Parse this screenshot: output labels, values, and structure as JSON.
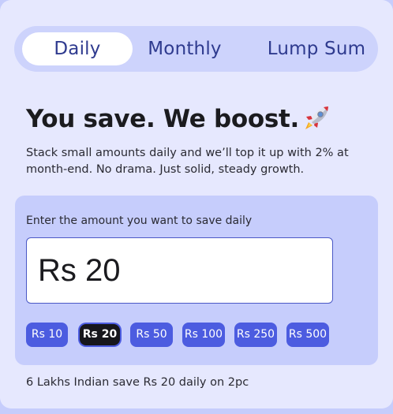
{
  "tabs": [
    {
      "label": "Daily",
      "active": true
    },
    {
      "label": "Monthly",
      "active": false
    },
    {
      "label": "Lump Sum",
      "active": false
    }
  ],
  "headline": {
    "text": "You save. We boost.",
    "icon": "rocket-icon"
  },
  "description": "Stack small amounts daily and we’ll top it up with 2% at month-end. No drama. Just solid, steady growth.",
  "amount": {
    "label": "Enter the amount you want to save daily",
    "value": "Rs 20"
  },
  "quick_amounts": [
    {
      "label": "Rs 10",
      "selected": false
    },
    {
      "label": "Rs 20",
      "selected": true
    },
    {
      "label": "Rs 50",
      "selected": false
    },
    {
      "label": "Rs 100",
      "selected": false
    },
    {
      "label": "Rs 250",
      "selected": false
    },
    {
      "label": "Rs 500",
      "selected": false
    }
  ],
  "footnote": "6 Lakhs Indian save Rs 20 daily on 2pc",
  "colors": {
    "page_background": "#c6cdfc",
    "card_background": "#e6e8fe",
    "accent": "#4c5ce0",
    "selected_chip": "#17171c",
    "tab_text": "#2f3b8f"
  }
}
